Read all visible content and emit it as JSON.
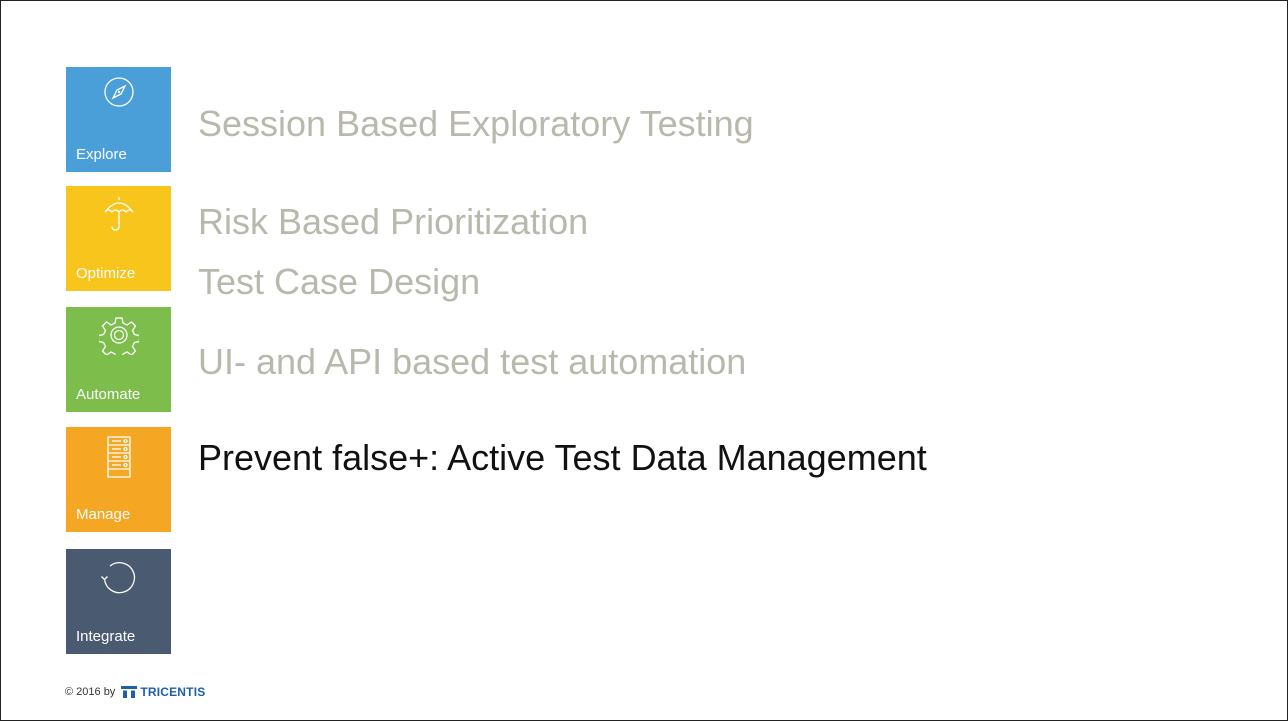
{
  "tiles": [
    {
      "label": "Explore",
      "icon": "compass-icon",
      "color": "#4A9FD9"
    },
    {
      "label": "Optimize",
      "icon": "umbrella-icon",
      "color": "#F7C51B"
    },
    {
      "label": "Automate",
      "icon": "gear-icon",
      "color": "#7DBD4B"
    },
    {
      "label": "Manage",
      "icon": "server-icon",
      "color": "#F5A623"
    },
    {
      "label": "Integrate",
      "icon": "cycle-icon",
      "color": "#4A5A70"
    }
  ],
  "lines": [
    {
      "text": "Session Based Exploratory Testing",
      "color": "#B9B8AD"
    },
    {
      "text": "Risk Based Prioritization",
      "color": "#B9B8AD"
    },
    {
      "text": "Test Case Design",
      "color": "#B9B8AD"
    },
    {
      "text": "UI- and API based test automation",
      "color": "#B9B8AD"
    },
    {
      "text": "Prevent false+: Active Test Data Management",
      "color": "#111111"
    }
  ],
  "footer": {
    "copyright": "© 2016 by",
    "logo_text": "TRICENTIS",
    "logo_color": "#1F5FAA"
  }
}
